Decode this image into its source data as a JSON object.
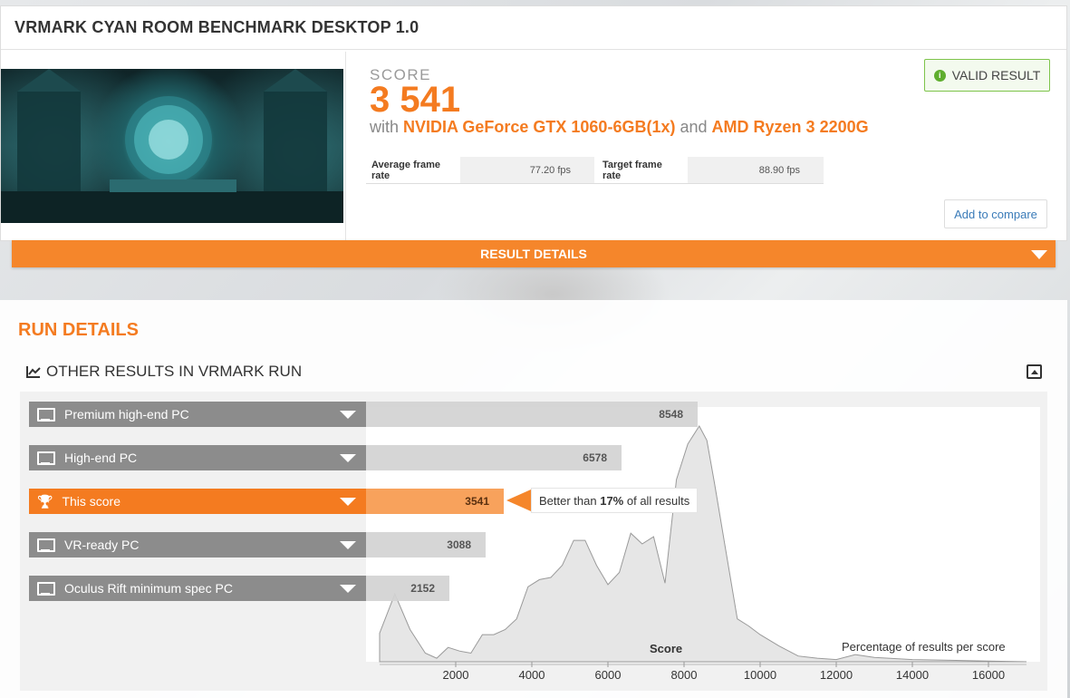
{
  "header": {
    "title": "VRMARK CYAN ROOM BENCHMARK DESKTOP 1.0"
  },
  "score": {
    "label": "SCORE",
    "value": "3 541",
    "with_prefix": "with",
    "gpu": "NVIDIA GeForce GTX 1060-6GB(1x)",
    "and": "and",
    "cpu": "AMD Ryzen 3 2200G",
    "avg_fps_label": "Average frame rate",
    "avg_fps_value": "77.20 fps",
    "target_fps_label": "Target frame rate",
    "target_fps_value": "88.90 fps"
  },
  "badge": {
    "label": "VALID RESULT",
    "icon": "info-icon",
    "color": "#5fae2e"
  },
  "compare_label": "Add to compare",
  "result_details_label": "RESULT DETAILS",
  "run": {
    "title": "RUN DETAILS",
    "other_title": "OTHER RESULTS IN VRMARK RUN",
    "accent": "#f47b20"
  },
  "rows": [
    {
      "label": "Premium high-end PC",
      "value": "8548",
      "icon": "monitor-icon"
    },
    {
      "label": "High-end PC",
      "value": "6578",
      "icon": "monitor-icon"
    },
    {
      "label": "This score",
      "value": "3541",
      "icon": "trophy-icon"
    },
    {
      "label": "VR-ready PC",
      "value": "3088",
      "icon": "monitor-icon"
    },
    {
      "label": "Oculus Rift minimum spec PC",
      "value": "2152",
      "icon": "monitor-icon"
    }
  ],
  "tooltip": {
    "prefix": "Better than ",
    "percent": "17%",
    "suffix": " of all results"
  },
  "chart_data": {
    "type": "area",
    "xlabel": "Score",
    "ylabel": "Percentage of results per score",
    "x_ticks": [
      "2000",
      "4000",
      "6000",
      "8000",
      "10000",
      "12000",
      "14000",
      "16000"
    ],
    "xlim": [
      0,
      17000
    ],
    "x": [
      0,
      400,
      800,
      1200,
      1500,
      1800,
      2100,
      2400,
      2700,
      3000,
      3300,
      3600,
      3900,
      4200,
      4500,
      4800,
      5100,
      5400,
      5700,
      6000,
      6300,
      6600,
      6900,
      7200,
      7500,
      7800,
      8100,
      8400,
      8600,
      8800,
      9100,
      9400,
      9700,
      10000,
      10500,
      11000,
      11500,
      12000,
      12500,
      13000,
      14000,
      15000,
      16000,
      17000
    ],
    "y": [
      0.4,
      0.95,
      0.45,
      0.12,
      0.05,
      0.2,
      0.15,
      0.12,
      0.38,
      0.38,
      0.45,
      0.6,
      1.05,
      1.15,
      1.18,
      1.35,
      1.7,
      1.7,
      1.35,
      1.08,
      1.25,
      1.8,
      1.65,
      1.75,
      1.1,
      2.55,
      3.05,
      3.3,
      3.1,
      2.5,
      1.55,
      0.6,
      0.5,
      0.38,
      0.22,
      0.08,
      0.05,
      0.03,
      0.1,
      0.06,
      0.03,
      0.02,
      0.01,
      0.0
    ]
  }
}
